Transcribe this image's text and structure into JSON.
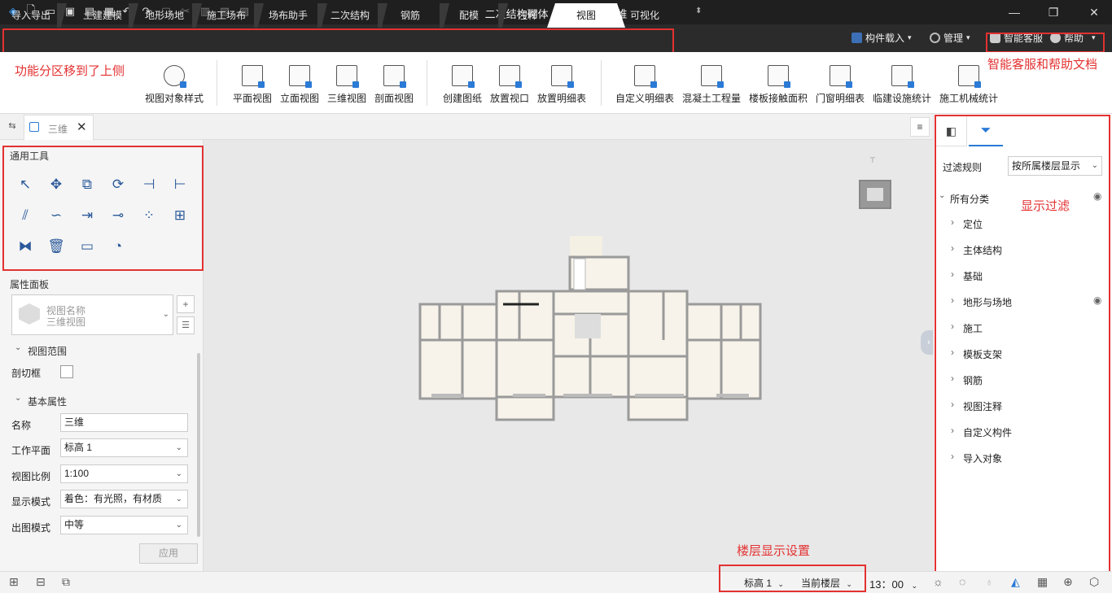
{
  "window": {
    "title": "二次结构砌体 - 三维视图: 三维"
  },
  "tabs": [
    {
      "label": "导入导出"
    },
    {
      "label": "土建建模"
    },
    {
      "label": "地形场地"
    },
    {
      "label": "施工场布"
    },
    {
      "label": "场布助手"
    },
    {
      "label": "二次结构"
    },
    {
      "label": "钢筋"
    },
    {
      "label": "配模"
    },
    {
      "label": "注释"
    },
    {
      "label": "视图"
    },
    {
      "label": "可视化"
    }
  ],
  "header_right": {
    "component_load": "构件载入",
    "manage": "管理",
    "smart_service": "智能客服",
    "help": "帮助"
  },
  "annotations": {
    "ribbon_note": "功能分区移到了上侧",
    "help_note": "智能客服和帮助文档",
    "filter_note": "显示过滤",
    "floor_note": "楼层显示设置"
  },
  "ribbon": {
    "items": [
      {
        "label": "视图对象样式"
      },
      {
        "label": "平面视图"
      },
      {
        "label": "立面视图"
      },
      {
        "label": "三维视图"
      },
      {
        "label": "剖面视图"
      },
      {
        "label": "创建图纸"
      },
      {
        "label": "放置视口"
      },
      {
        "label": "放置明细表"
      },
      {
        "label": "自定义明细表"
      },
      {
        "label": "混凝土工程量"
      },
      {
        "label": "楼板接触面积"
      },
      {
        "label": "门窗明细表"
      },
      {
        "label": "临建设施统计"
      },
      {
        "label": "施工机械统计"
      }
    ]
  },
  "doc_tab": {
    "label": "三维"
  },
  "tools": {
    "title": "通用工具"
  },
  "properties": {
    "title": "属性面板",
    "view_name_label": "视图名称",
    "view_name_value": "三维视图",
    "section_view_range": "视图范围",
    "clip_box_label": "剖切框",
    "section_basic": "基本属性",
    "rows": [
      {
        "label": "名称",
        "value": "三维"
      },
      {
        "label": "工作平面",
        "value": "标高 1"
      },
      {
        "label": "视图比例",
        "value": "1:100"
      },
      {
        "label": "显示模式",
        "value": "着色：有光照，有材质"
      },
      {
        "label": "出图模式",
        "value": "中等"
      }
    ],
    "apply": "应用"
  },
  "filter": {
    "rule_label": "过滤规则",
    "rule_value": "按所属楼层显示",
    "root": "所有分类",
    "items": [
      {
        "label": "定位"
      },
      {
        "label": "主体结构"
      },
      {
        "label": "基础"
      },
      {
        "label": "地形与场地"
      },
      {
        "label": "施工"
      },
      {
        "label": "模板支架"
      },
      {
        "label": "钢筋"
      },
      {
        "label": "视图注释"
      },
      {
        "label": "自定义构件"
      },
      {
        "label": "导入对象"
      }
    ]
  },
  "status": {
    "level": "标高 1",
    "floor": "当前楼层",
    "time": "13：00"
  },
  "colors": {
    "accent": "#2a7ad6",
    "annotation": "#e33131",
    "titlebar": "#1f1f1f"
  }
}
